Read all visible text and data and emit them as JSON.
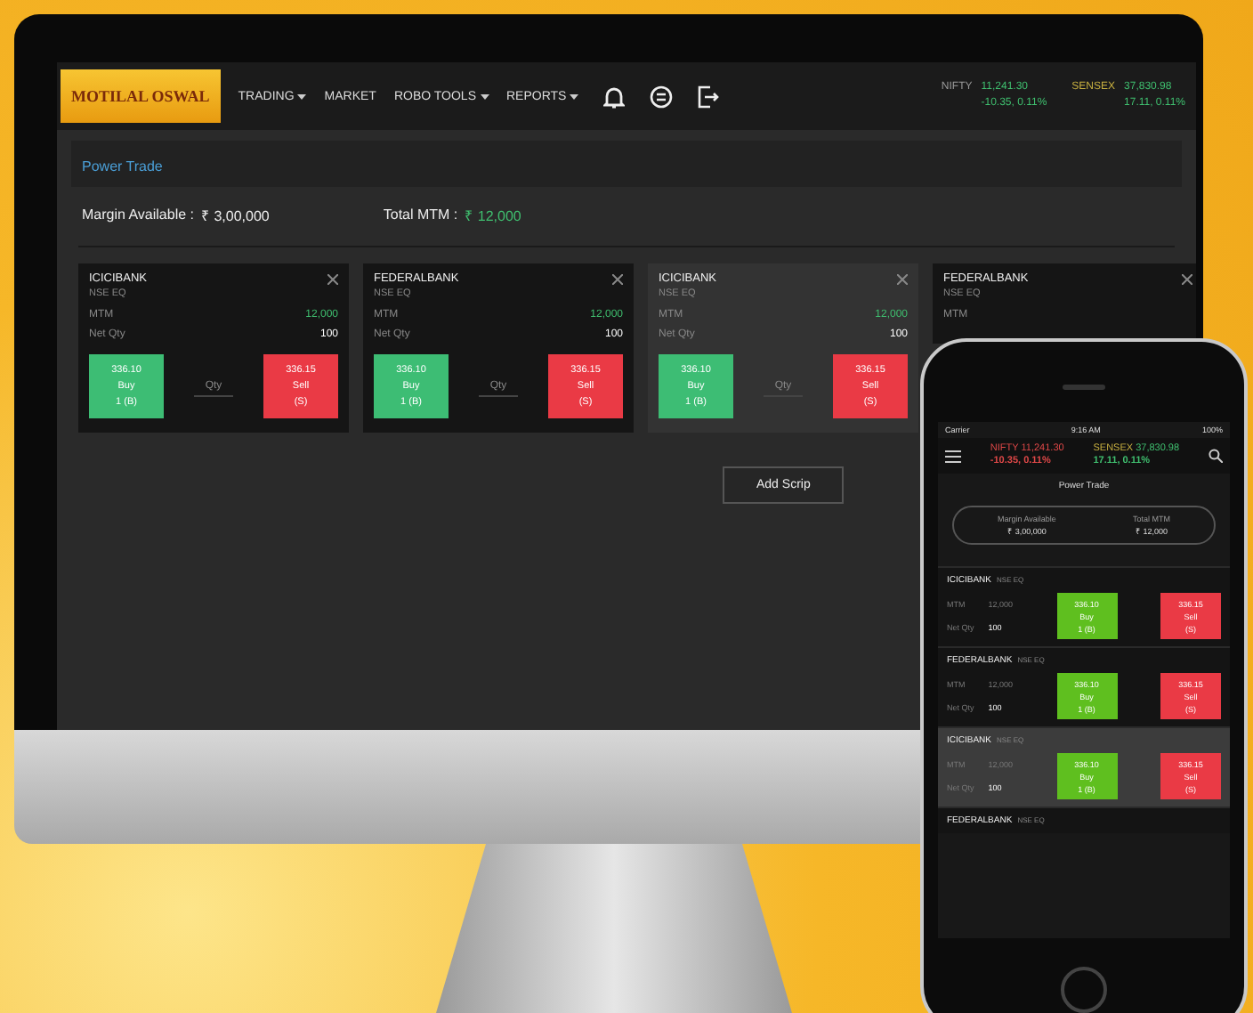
{
  "desktop": {
    "logo": "MOTILAL OSWAL",
    "menu": [
      {
        "label": "TRADING",
        "dropdown": true
      },
      {
        "label": "MARKET",
        "dropdown": false
      },
      {
        "label": "ROBO TOOLS",
        "dropdown": true
      },
      {
        "label": "REPORTS",
        "dropdown": true
      }
    ],
    "indices": [
      {
        "name": "NIFTY",
        "value": "11,241.30",
        "change": "-10.35, 0.11%",
        "color": "#3fbf6f"
      },
      {
        "name": "SENSEX",
        "value": "37,830.98",
        "change": "17.11, 0.11%",
        "color": "#3fbf6f"
      }
    ],
    "page_title": "Power Trade",
    "margin_label": "Margin Available :",
    "margin_value": "₹ 3,00,000",
    "mtm_label": "Total MTM :",
    "mtm_value": "₹ 12,000",
    "cards": [
      {
        "symbol": "ICICIBANK",
        "exchange": "NSE EQ",
        "mtm_label": "MTM",
        "mtm": "12,000",
        "qty_label": "Net Qty",
        "qty": "100",
        "buy_price": "336.10",
        "buy": "Buy",
        "buy_qty": "1 (B)",
        "lot": "Qty",
        "sell_price": "336.15",
        "sell": "Sell",
        "sell_qty": "(S)",
        "selected": false
      },
      {
        "symbol": "FEDERALBANK",
        "exchange": "NSE EQ",
        "mtm_label": "MTM",
        "mtm": "12,000",
        "qty_label": "Net Qty",
        "qty": "100",
        "buy_price": "336.10",
        "buy": "Buy",
        "buy_qty": "1 (B)",
        "lot": "Qty",
        "sell_price": "336.15",
        "sell": "Sell",
        "sell_qty": "(S)",
        "selected": false
      },
      {
        "symbol": "ICICIBANK",
        "exchange": "NSE EQ",
        "mtm_label": "MTM",
        "mtm": "12,000",
        "qty_label": "Net Qty",
        "qty": "100",
        "buy_price": "336.10",
        "buy": "Buy",
        "buy_qty": "1 (B)",
        "lot": "Qty",
        "sell_price": "336.15",
        "sell": "Sell",
        "sell_qty": "(S)",
        "selected": true
      },
      {
        "symbol": "FEDERALBANK",
        "exchange": "NSE EQ",
        "mtm_label": "MTM",
        "selected": false
      }
    ],
    "add_scrip": "Add Scrip"
  },
  "phone": {
    "carrier": "Carrier",
    "time": "9:16 AM",
    "battery": "100%",
    "indices": [
      {
        "name": "NIFTY",
        "value": "11,241.30",
        "change": "-10.35, 0.11%",
        "color": "#e04848"
      },
      {
        "name": "SENSEX",
        "value": "37,830.98",
        "change": "17.11, 0.11%",
        "color": "#3fbf6f"
      }
    ],
    "page_title": "Power Trade",
    "margin_label": "Margin Available",
    "margin_value": "₹ 3,00,000",
    "mtm_label": "Total MTM",
    "mtm_value": "₹ 12,000",
    "rows": [
      {
        "symbol": "ICICIBANK",
        "exchange": "NSE EQ",
        "mtm_label": "MTM",
        "mtm": "12,000",
        "qty_label": "Net Qty",
        "qty": "100",
        "buy_price": "336.10",
        "buy": "Buy",
        "buy_qty": "1 (B)",
        "sell_price": "336.15",
        "sell": "Sell",
        "sell_qty": "(S)",
        "selected": false
      },
      {
        "symbol": "FEDERALBANK",
        "exchange": "NSE EQ",
        "mtm_label": "MTM",
        "mtm": "12,000",
        "qty_label": "Net Qty",
        "qty": "100",
        "buy_price": "336.10",
        "buy": "Buy",
        "buy_qty": "1 (B)",
        "sell_price": "336.15",
        "sell": "Sell",
        "sell_qty": "(S)",
        "selected": false
      },
      {
        "symbol": "ICICIBANK",
        "exchange": "NSE EQ",
        "mtm_label": "MTM",
        "mtm": "12,000",
        "qty_label": "Net Qty",
        "qty": "100",
        "buy_price": "336.10",
        "buy": "Buy",
        "buy_qty": "1 (B)",
        "sell_price": "336.15",
        "sell": "Sell",
        "sell_qty": "(S)",
        "selected": true
      },
      {
        "symbol": "FEDERALBANK",
        "exchange": "NSE EQ",
        "selected": false
      }
    ]
  }
}
